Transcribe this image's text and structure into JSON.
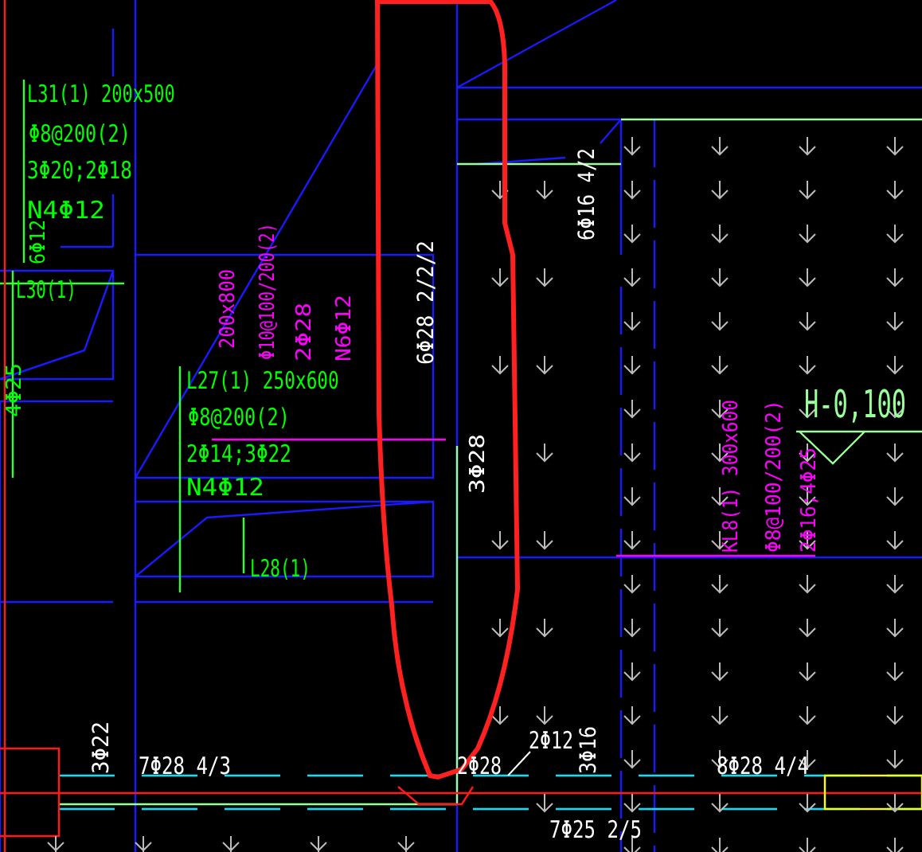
{
  "canvas": {
    "annotations": [
      {
        "text": "L31(1) 200x500",
        "kind": "horizontal",
        "color": "#00ff00"
      },
      {
        "text": "Φ8@200(2)",
        "kind": "horizontal",
        "color": "#00ff00"
      },
      {
        "text": "3Φ20;2Φ18",
        "kind": "horizontal",
        "color": "#00ff00"
      },
      {
        "text": "N4Φ12",
        "kind": "horizontal",
        "color": "#00ff00"
      },
      {
        "text": "6Φ12",
        "kind": "vertical",
        "color": "#00ff00"
      },
      {
        "text": "L30(1)",
        "kind": "horizontal",
        "color": "#00ff00"
      },
      {
        "text": "4Φ25",
        "kind": "vertical",
        "color": "#00ff00"
      },
      {
        "text": "200x800",
        "kind": "vertical",
        "color": "#ff00ff"
      },
      {
        "text": "Φ10@100/200(2)",
        "kind": "vertical",
        "color": "#ff00ff"
      },
      {
        "text": "L27(1) 250x600",
        "kind": "horizontal",
        "color": "#00ff00"
      },
      {
        "text": "2Φ28",
        "kind": "vertical",
        "color": "#ff00ff"
      },
      {
        "text": "N6Φ12",
        "kind": "vertical",
        "color": "#ff00ff"
      },
      {
        "text": "Φ8@200(2)",
        "kind": "horizontal",
        "color": "#00ff00"
      },
      {
        "text": "2Φ14;3Φ22",
        "kind": "horizontal",
        "color": "#00ff00"
      },
      {
        "text": "N4Φ12",
        "kind": "horizontal",
        "color": "#00ff00"
      },
      {
        "text": "L28(1)",
        "kind": "horizontal",
        "color": "#00ff00"
      },
      {
        "text": "6Φ28 2/2/2",
        "kind": "vertical",
        "color": "#ffffff"
      },
      {
        "text": "6Φ16 4/2",
        "kind": "vertical",
        "color": "#ffffff"
      },
      {
        "text": "3Φ28",
        "kind": "vertical",
        "color": "#ffffff"
      },
      {
        "text": "H-0,100",
        "kind": "horizontal",
        "color": "#99ff99"
      },
      {
        "text": "KL8(1) 300x600",
        "kind": "vertical",
        "color": "#ff00ff"
      },
      {
        "text": "Φ8@100/200(2)",
        "kind": "vertical",
        "color": "#ff00ff"
      },
      {
        "text": "2Φ16;4Φ25",
        "kind": "vertical",
        "color": "#ff00ff"
      },
      {
        "text": "3Φ22",
        "kind": "vertical",
        "color": "#ffffff"
      },
      {
        "text": "7Φ28 4/3",
        "kind": "horizontal",
        "color": "#ffffff"
      },
      {
        "text": "2Φ12",
        "kind": "horizontal",
        "color": "#ffffff"
      },
      {
        "text": "3Φ16",
        "kind": "vertical",
        "color": "#ffffff"
      },
      {
        "text": "2Φ28",
        "kind": "horizontal",
        "color": "#ffffff"
      },
      {
        "text": "8Φ28 4/4",
        "kind": "horizontal",
        "color": "#ffffff"
      },
      {
        "text": "7Φ25 2/5",
        "kind": "horizontal",
        "color": "#ffffff"
      }
    ]
  }
}
